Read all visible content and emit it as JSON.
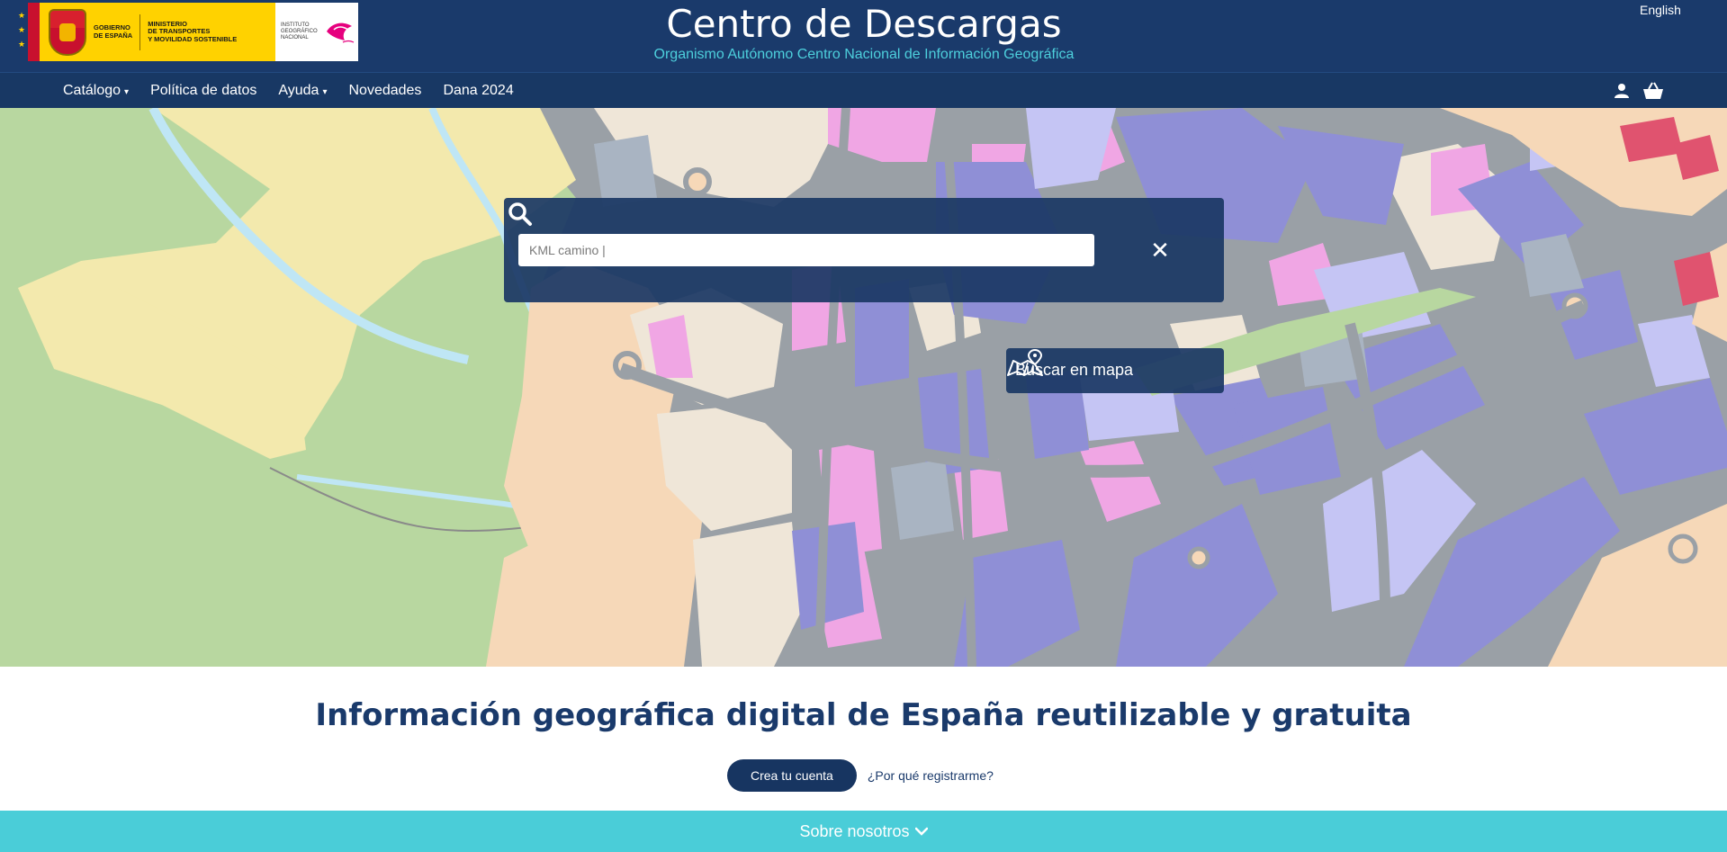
{
  "header": {
    "gov_text": "GOBIERNO\nDE ESPAÑA",
    "ministry_text": "MINISTERIO\nDE TRANSPORTES\nY MOVILIDAD SOSTENIBLE",
    "ign_text": "INSTITUTO\nGEOGRÁFICO\nNACIONAL",
    "title": "Centro de Descargas",
    "subtitle": "Organismo Autónomo Centro Nacional de Información Geográfica",
    "language_link": "English"
  },
  "nav": {
    "items": [
      {
        "label": "Catálogo",
        "caret": "▾"
      },
      {
        "label": "Política de datos",
        "caret": ""
      },
      {
        "label": "Ayuda",
        "caret": "▾"
      },
      {
        "label": "Novedades",
        "caret": ""
      },
      {
        "label": "Dana 2024",
        "caret": ""
      }
    ],
    "icons": [
      "user-icon",
      "basket-icon"
    ]
  },
  "search": {
    "value": "KML camino |",
    "placeholder": "KML camino |",
    "search_icon": "search-icon",
    "clear_icon": "close-icon",
    "clear_glyph": "✕"
  },
  "map_search": {
    "label": "Buscar en mapa",
    "icon": "map-pin-icon"
  },
  "main": {
    "tagline": "Información geográfica digital de España reutilizable y gratuita",
    "create_account": "Crea tu cuenta",
    "why_register": "¿Por qué registrarme?"
  },
  "footer_bar": {
    "label": "Sobre nosotros",
    "chevron": "❯"
  },
  "colors": {
    "header_bg": "#1a3a6b",
    "accent_cyan": "#4acdd8",
    "map_road": "#9aa0a6",
    "map_violet": "#8f8fd6",
    "map_pink": "#f0a6e4",
    "map_beige": "#efe6d8",
    "map_green": "#b8d7a0",
    "map_yellow": "#f3e9ad",
    "map_peach": "#f6d8b8",
    "map_water": "#bfe6f5"
  }
}
